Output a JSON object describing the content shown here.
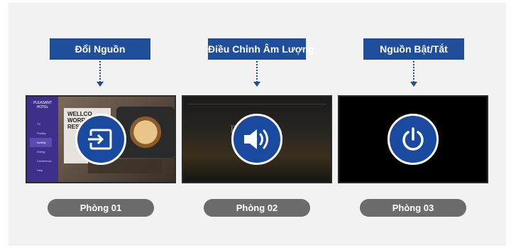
{
  "diagram": {
    "columns": [
      {
        "label": "Đổi Nguồn",
        "icon": "input-source-icon",
        "room": "Phòng 01",
        "screen_content": {
          "hotel_logo": "PLEASANT\nHOTEL",
          "menu": [
            "TV",
            "Facility",
            "Activity",
            "Dining",
            "Conference",
            "Help"
          ],
          "card_text": "WELLCO\nWORR\nREST"
        }
      },
      {
        "label": "Điều Chỉnh Âm Lượng",
        "icon": "volume-icon",
        "room": "Phòng 02",
        "screen_content": {
          "faded_text": "PLE       TEL"
        }
      },
      {
        "label": "Nguồn Bật/Tắt",
        "icon": "power-icon",
        "room": "Phòng 03"
      }
    ],
    "colors": {
      "label_bg": "#1f4e9a",
      "icon_circle": "#1a4aa0",
      "pill_bg": "#6c6c6c",
      "stage_bg": "#f2f2f2"
    }
  }
}
